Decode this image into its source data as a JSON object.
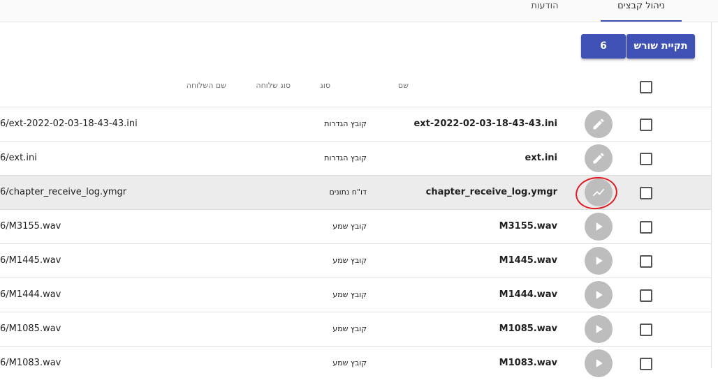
{
  "tabs": [
    {
      "label": "ניהול קבצים",
      "active": true
    },
    {
      "label": "הודעות",
      "active": false
    }
  ],
  "toolbar": {
    "root_label": "תקיית שורש",
    "count_label": "6"
  },
  "headers": {
    "name": "שם",
    "type": "סוג",
    "ext_type": "סוג שלוחה",
    "ext_name": "שם השלוחה"
  },
  "rows": [
    {
      "name": "ext-2022-02-03-18-43-43.ini",
      "type": "קובץ הגדרות",
      "path": "6/ext-2022-02-03-18-43-43.ini",
      "icon": "edit-icon"
    },
    {
      "name": "ext.ini",
      "type": "קובץ הגדרות",
      "path": "6/ext.ini",
      "icon": "edit-icon"
    },
    {
      "name": "chapter_receive_log.ymgr",
      "type": "דו\"ח נתונים",
      "path": "6/chapter_receive_log.ymgr",
      "icon": "chart-line-icon"
    },
    {
      "name": "M3155.wav",
      "type": "קובץ שמע",
      "path": "6/M3155.wav",
      "icon": "play-icon"
    },
    {
      "name": "M1445.wav",
      "type": "קובץ שמע",
      "path": "6/M1445.wav",
      "icon": "play-icon"
    },
    {
      "name": "M1444.wav",
      "type": "קובץ שמע",
      "path": "6/M1444.wav",
      "icon": "play-icon"
    },
    {
      "name": "M1085.wav",
      "type": "קובץ שמע",
      "path": "6/M1085.wav",
      "icon": "play-icon"
    },
    {
      "name": "M1083.wav",
      "type": "קובץ שמע",
      "path": "6/M1083.wav",
      "icon": "play-icon"
    }
  ],
  "colors": {
    "accent": "#3f51b5",
    "action_bg": "#bdbdbd",
    "highlight_row": "#ececec",
    "annotation": "#e01b24"
  }
}
